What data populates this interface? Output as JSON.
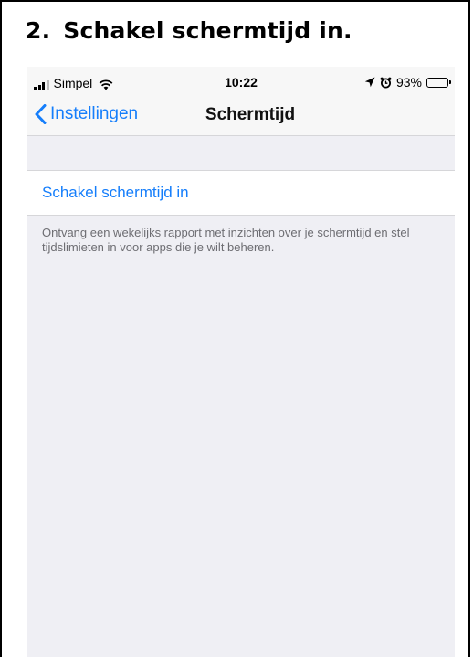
{
  "document": {
    "step_number": "2.",
    "step_title": "Schakel schermtijd in."
  },
  "statusbar": {
    "carrier": "Simpel",
    "time": "10:22",
    "battery_percent": "93%",
    "battery_level": 0.93,
    "icons": [
      "signal-icon",
      "wifi-icon",
      "location-arrow-icon",
      "alarm-icon",
      "battery-icon"
    ]
  },
  "navbar": {
    "back_label": "Instellingen",
    "title": "Schermtijd"
  },
  "settings": {
    "toggle_cell_label": "Schakel schermtijd in",
    "footer_text": "Ontvang een wekelijks rapport met inzichten over je schermtijd en stel tijdslimieten in voor apps die je wilt beheren."
  },
  "colors": {
    "ios_blue": "#157efb",
    "grouped_background": "#efeff4",
    "bar_background": "#f7f7f7",
    "footer_gray": "#6d6d72"
  }
}
